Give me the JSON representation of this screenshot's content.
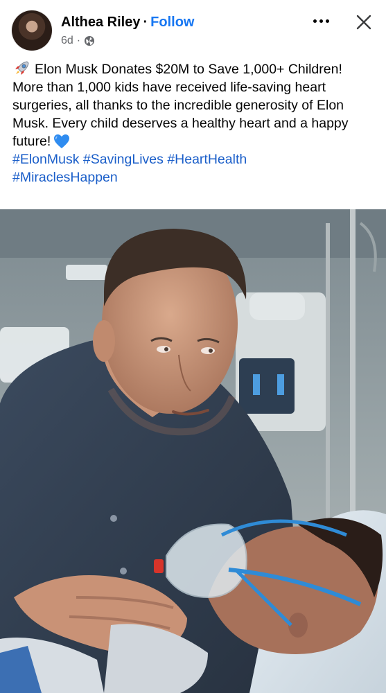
{
  "post": {
    "author": "Althea Riley",
    "separator": "·",
    "follow_label": "Follow",
    "time": "6d",
    "meta_separator": "·",
    "audience_icon": "globe-icon",
    "headline_emoji_icon": "rocket-icon",
    "headline": "Elon Musk Donates $20M to Save 1,000+ Children!",
    "body": "More than 1,000 kids have received life-saving heart surgeries, all thanks to the incredible generosity of Elon Musk. Every child deserves a healthy heart and a happy future!",
    "body_emoji_icon": "blue-heart-icon",
    "hashtags": [
      "#ElonMusk",
      "#SavingLives",
      "#HeartHealth",
      "#MiraclesHappen"
    ]
  },
  "actions": {
    "more_icon": "more-options-icon",
    "close_icon": "close-icon"
  },
  "colors": {
    "follow_blue": "#1877f2",
    "hashtag_blue": "#1a5ec9",
    "secondary_text": "#65676b",
    "heart_blue": "#2f8cf0"
  }
}
